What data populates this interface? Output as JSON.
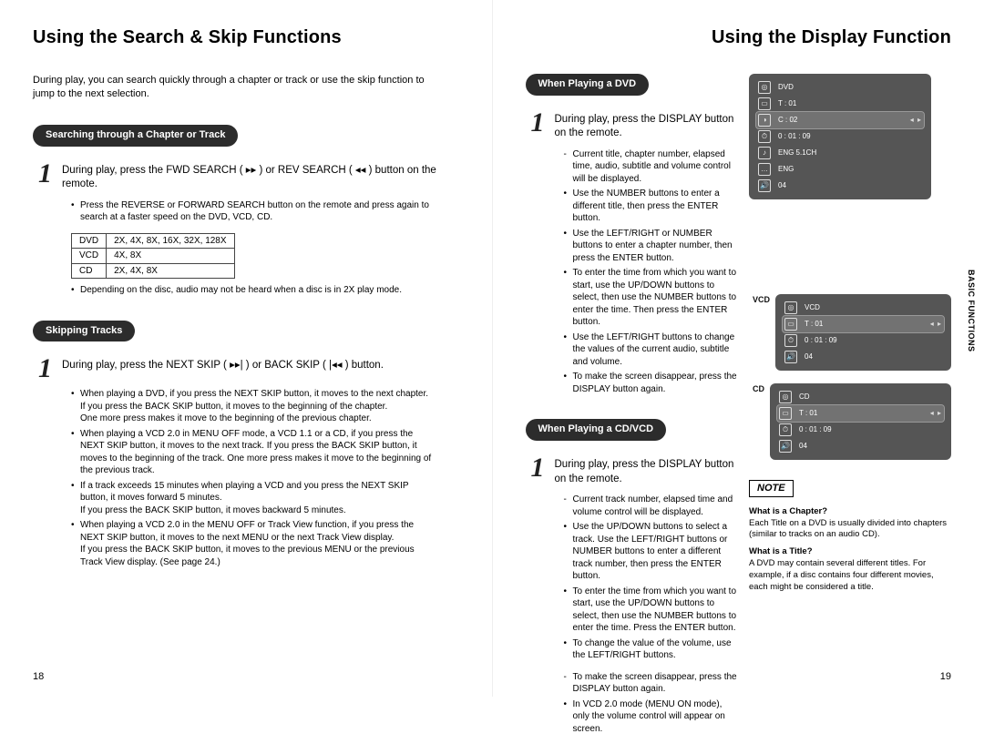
{
  "left": {
    "title": "Using the Search & Skip Functions",
    "intro": "During play, you can search quickly through a chapter or track or use the skip function to jump to the next selection.",
    "section1": {
      "label": "Searching through a Chapter or Track",
      "step": "During play, press the FWD SEARCH ( ▸▸ ) or REV SEARCH ( ◂◂ ) button on the remote.",
      "bullets": [
        "Press the REVERSE or FORWARD SEARCH button on the remote and press again to search at a faster speed on the DVD, VCD, CD."
      ],
      "table": [
        [
          "DVD",
          "2X, 4X, 8X, 16X, 32X, 128X"
        ],
        [
          "VCD",
          "4X, 8X"
        ],
        [
          "CD",
          "2X, 4X, 8X"
        ]
      ],
      "footnote": "Depending on the disc, audio may not be heard when a disc is in 2X play mode."
    },
    "section2": {
      "label": "Skipping Tracks",
      "step": "During play, press the NEXT SKIP ( ▸▸| ) or BACK SKIP ( |◂◂ ) button.",
      "bullets": [
        "When playing a DVD, if you press the NEXT SKIP button, it moves to the next chapter. If you press the BACK SKIP button, it moves to the beginning of the chapter.\nOne more press makes it move to the beginning of the previous chapter.",
        "When playing a VCD 2.0 in MENU OFF mode, a VCD 1.1 or a CD, if you press the NEXT SKIP button, it moves to the next track. If you press the BACK SKIP button, it moves to the beginning of the track. One more press makes it move to the beginning of the previous track.",
        "If a track exceeds 15 minutes when playing a VCD and you press the NEXT SKIP button, it moves forward 5 minutes.\nIf you press the BACK SKIP button, it moves backward 5 minutes.",
        "When playing a VCD 2.0 in the MENU OFF or Track View function, if you press the NEXT SKIP button, it moves to the next MENU or the next Track View display.\nIf you press the BACK SKIP button, it moves to the previous MENU or the previous Track View display. (See page 24.)"
      ]
    },
    "pagenum": "18"
  },
  "right": {
    "title": "Using the Display Function",
    "section1": {
      "label": "When Playing a DVD",
      "step": "During play, press the DISPLAY button on the remote.",
      "dash": "Current title, chapter number, elapsed time, audio, subtitle and volume control will be displayed.",
      "bullets": [
        "Use the NUMBER buttons to enter a different title, then press the ENTER button.",
        "Use the LEFT/RIGHT or NUMBER buttons to enter a chapter number, then press the ENTER button.",
        "To enter the time from which you want to start, use the UP/DOWN buttons to select, then use the NUMBER buttons to enter the time. Then press the ENTER button.",
        "Use the LEFT/RIGHT buttons to change the values of the current audio, subtitle and volume.",
        "To make the screen disappear, press the DISPLAY button again."
      ]
    },
    "section2": {
      "label": "When Playing a CD/VCD",
      "step": "During play, press the DISPLAY button on the remote.",
      "dash": "Current track number, elapsed time and volume control will be displayed.",
      "bullets": [
        "Use the UP/DOWN buttons to select a track. Use the LEFT/RIGHT buttons or NUMBER buttons to enter a different track number, then press the ENTER button.",
        "To enter the time from which you want to start, use the UP/DOWN buttons to select, then use the NUMBER buttons to enter the time. Press the ENTER button.",
        "To change the value of the volume, use the LEFT/RIGHT buttons."
      ],
      "dash2": "To make the screen disappear, press the DISPLAY button again.",
      "bullets2": [
        "In VCD 2.0 mode (MENU ON mode), only the volume control will appear on screen."
      ]
    },
    "osd_dvd": {
      "rows": [
        {
          "icon": "◎",
          "text": "DVD"
        },
        {
          "icon": "▭",
          "text": "T : 01"
        },
        {
          "icon": "◑",
          "text": "C : 02",
          "sel": true,
          "arrows": "◂ ▸"
        },
        {
          "icon": "⏱",
          "text": "0 : 01 : 09"
        },
        {
          "icon": "♪",
          "text": "ENG 5.1CH"
        },
        {
          "icon": "…",
          "text": "ENG"
        },
        {
          "icon": "🔊",
          "text": "04"
        }
      ]
    },
    "osd_vcd": {
      "label": "VCD",
      "rows": [
        {
          "icon": "◎",
          "text": "VCD"
        },
        {
          "icon": "▭",
          "text": "T : 01",
          "sel": true,
          "arrows": "◂ ▸"
        },
        {
          "icon": "⏱",
          "text": "0 : 01 : 09"
        },
        {
          "icon": "🔊",
          "text": "04"
        }
      ]
    },
    "osd_cd": {
      "label": "CD",
      "rows": [
        {
          "icon": "◎",
          "text": "CD"
        },
        {
          "icon": "▭",
          "text": "T : 01",
          "sel": true,
          "arrows": "◂ ▸"
        },
        {
          "icon": "⏱",
          "text": "0 : 01 : 09"
        },
        {
          "icon": "🔊",
          "text": "04"
        }
      ]
    },
    "note_label": "NOTE",
    "notes": [
      {
        "q": "What is a Chapter?",
        "a": "Each Title on a DVD is usually divided into chapters (similar to tracks on an audio CD)."
      },
      {
        "q": "What is a Title?",
        "a": "A DVD may contain several different titles. For example, if a disc contains four different movies, each might be considered a title."
      }
    ],
    "sidetab": "BASIC FUNCTIONS",
    "pagenum": "19"
  }
}
